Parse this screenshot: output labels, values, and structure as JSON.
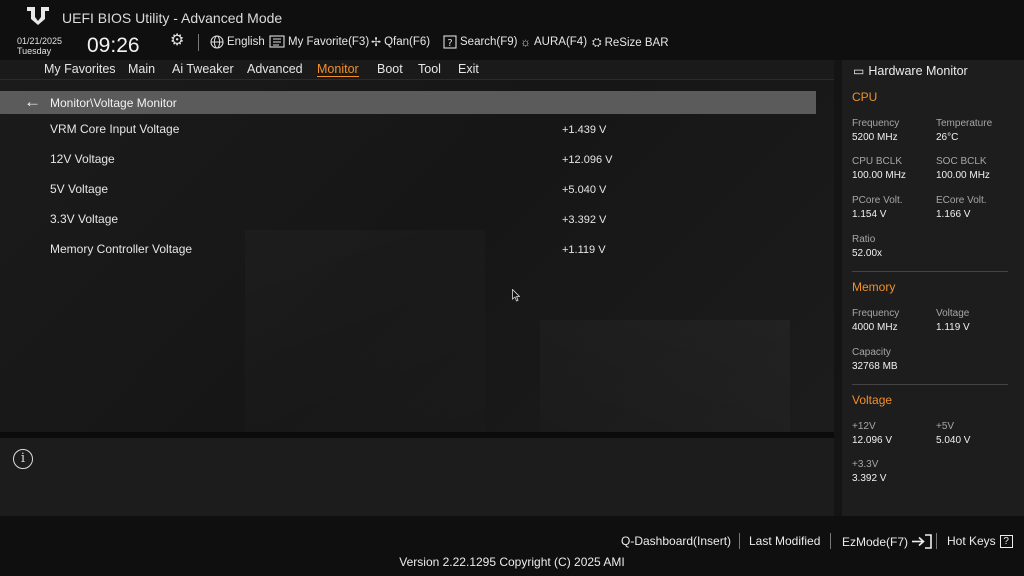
{
  "header": {
    "title": "UEFI BIOS Utility - Advanced Mode",
    "date": "01/21/2025",
    "day": "Tuesday",
    "time": "09:26",
    "tools": {
      "language": "English",
      "favorite": "My Favorite(F3)",
      "qfan": "Qfan(F6)",
      "search": "Search(F9)",
      "aura": "AURA(F4)",
      "resize_bar": "ReSize BAR"
    },
    "icons": [
      "gear-icon",
      "globe-icon",
      "favorite-icon",
      "fan-icon",
      "search-icon",
      "aura-icon",
      "resize-bar-icon"
    ]
  },
  "menu": {
    "items": [
      "My Favorites",
      "Main",
      "Ai Tweaker",
      "Advanced",
      "Monitor",
      "Boot",
      "Tool",
      "Exit"
    ],
    "active": "Monitor"
  },
  "main": {
    "breadcrumb": "Monitor\\Voltage Monitor",
    "rows": [
      {
        "label": "VRM Core Input Voltage",
        "value": "+1.439 V"
      },
      {
        "label": "12V Voltage",
        "value": "+12.096 V"
      },
      {
        "label": "5V Voltage",
        "value": "+5.040 V"
      },
      {
        "label": "3.3V Voltage",
        "value": "+3.392 V"
      },
      {
        "label": "Memory Controller Voltage",
        "value": "+1.119 V"
      }
    ]
  },
  "hardware_monitor": {
    "title": "Hardware Monitor",
    "cpu": {
      "heading": "CPU",
      "frequency_label": "Frequency",
      "frequency": "5200 MHz",
      "temperature_label": "Temperature",
      "temperature": "26°C",
      "cpu_bclk_label": "CPU BCLK",
      "cpu_bclk": "100.00 MHz",
      "soc_bclk_label": "SOC BCLK",
      "soc_bclk": "100.00 MHz",
      "pcore_label": "PCore Volt.",
      "pcore": "1.154 V",
      "ecore_label": "ECore Volt.",
      "ecore": "1.166 V",
      "ratio_label": "Ratio",
      "ratio": "52.00x"
    },
    "memory": {
      "heading": "Memory",
      "frequency_label": "Frequency",
      "frequency": "4000 MHz",
      "voltage_label": "Voltage",
      "voltage": "1.119 V",
      "capacity_label": "Capacity",
      "capacity": "32768 MB"
    },
    "voltage": {
      "heading": "Voltage",
      "v12_label": "+12V",
      "v12": "12.096 V",
      "v5_label": "+5V",
      "v5": "5.040 V",
      "v33_label": "+3.3V",
      "v33": "3.392 V"
    }
  },
  "footer": {
    "qdashboard": "Q-Dashboard(Insert)",
    "last_modified": "Last Modified",
    "ezmode": "EzMode(F7)",
    "hotkeys": "Hot Keys",
    "version": "Version 2.22.1295 Copyright (C) 2025 AMI"
  },
  "colors": {
    "accent": "#f0902a",
    "background": "#141414",
    "breadcrumb_bar": "#5b5b5b"
  }
}
